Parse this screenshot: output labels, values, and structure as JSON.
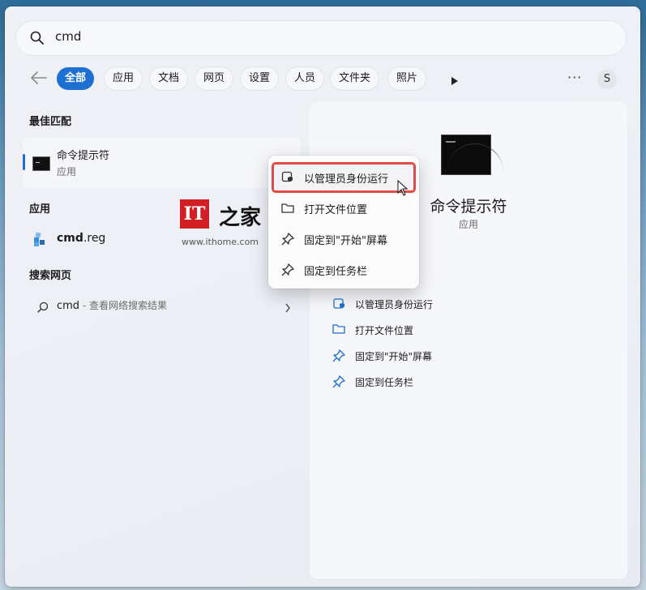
{
  "search": {
    "query": "cmd"
  },
  "filters": {
    "active": "全部",
    "chips": [
      "全部",
      "应用",
      "文档",
      "网页",
      "设置",
      "人员",
      "文件夹",
      "照片"
    ],
    "more_label": "···",
    "avatar_initial": "S"
  },
  "best_match": {
    "section_title": "最佳匹配",
    "name": "命令提示符",
    "type": "应用"
  },
  "apps": {
    "section_title": "应用",
    "item_bold": "cmd",
    "item_rest": ".reg"
  },
  "web": {
    "section_title": "搜索网页",
    "query": "cmd",
    "suffix": " - 查看网络搜索结果"
  },
  "watermark": {
    "logo": "IT",
    "name": "之家",
    "url": "www.ithome.com"
  },
  "context_menu": {
    "items": [
      "以管理员身份运行",
      "打开文件位置",
      "固定到\"开始\"屏幕",
      "固定到任务栏"
    ],
    "highlighted_index": 0
  },
  "preview": {
    "title": "命令提示符",
    "type": "应用",
    "actions": [
      "以管理员身份运行",
      "打开文件位置",
      "固定到\"开始\"屏幕",
      "固定到任务栏"
    ]
  },
  "colors": {
    "accent": "#1d6fd1",
    "highlight_box": "#e14b45",
    "watermark_logo": "#d21f26"
  }
}
